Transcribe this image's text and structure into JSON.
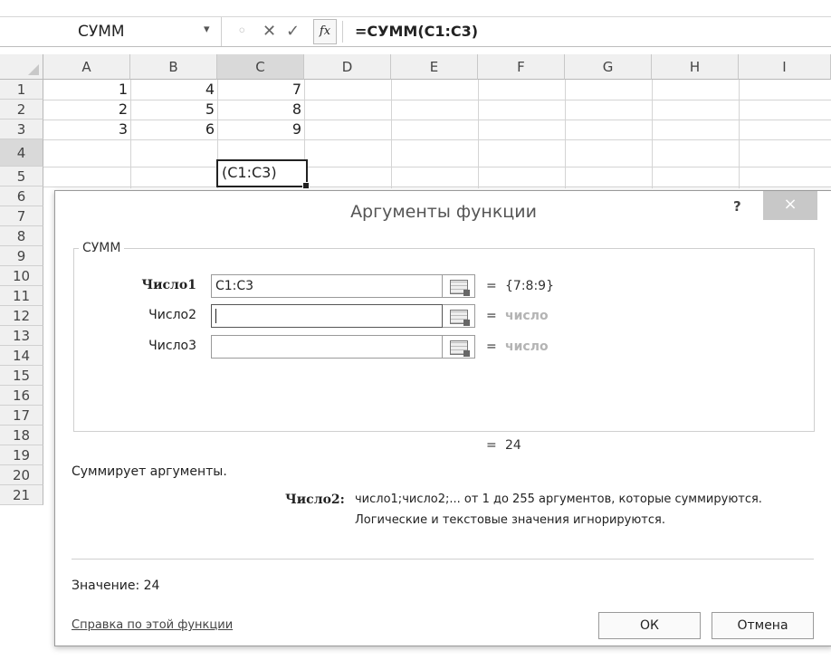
{
  "formula_bar": {
    "name_box": "СУММ",
    "dropdown_glyph": "▾",
    "cancel_glyph": "✕",
    "enter_glyph": "✓",
    "fx_label": "fx",
    "formula": "=СУММ(C1:C3)"
  },
  "columns": [
    "A",
    "B",
    "C",
    "D",
    "E",
    "F",
    "G",
    "H",
    "I"
  ],
  "rows": [
    "1",
    "2",
    "3",
    "4",
    "5",
    "6",
    "7",
    "8",
    "9",
    "10",
    "11",
    "12",
    "13",
    "14",
    "15",
    "16",
    "17",
    "18",
    "19",
    "20",
    "21"
  ],
  "cells": {
    "a1": "1",
    "b1": "4",
    "c1": "7",
    "a2": "2",
    "b2": "5",
    "c2": "8",
    "a3": "3",
    "b3": "6",
    "c3": "9",
    "c4": "(C1:C3)"
  },
  "dialog": {
    "title": "Аргументы функции",
    "help": "?",
    "close": "×",
    "function_name": "СУММ",
    "args": [
      {
        "label": "Число1",
        "value": "C1:C3",
        "equals": "=",
        "result": "{7:8:9}"
      },
      {
        "label": "Число2",
        "value": "",
        "equals": "=",
        "result": "число"
      },
      {
        "label": "Число3",
        "value": "",
        "equals": "=",
        "result": "число"
      }
    ],
    "total_equals": "=",
    "total_value": "24",
    "description": "Суммирует аргументы.",
    "arg_desc_label": "Число2:",
    "arg_desc_line1": "число1;число2;... от 1 до 255 аргументов, которые суммируются.",
    "arg_desc_line2": "Логические и текстовые значения игнорируются.",
    "value_line": "Значение:  24",
    "help_link": "Справка по этой функции",
    "ok": "ОК",
    "cancel": "Отмена"
  }
}
